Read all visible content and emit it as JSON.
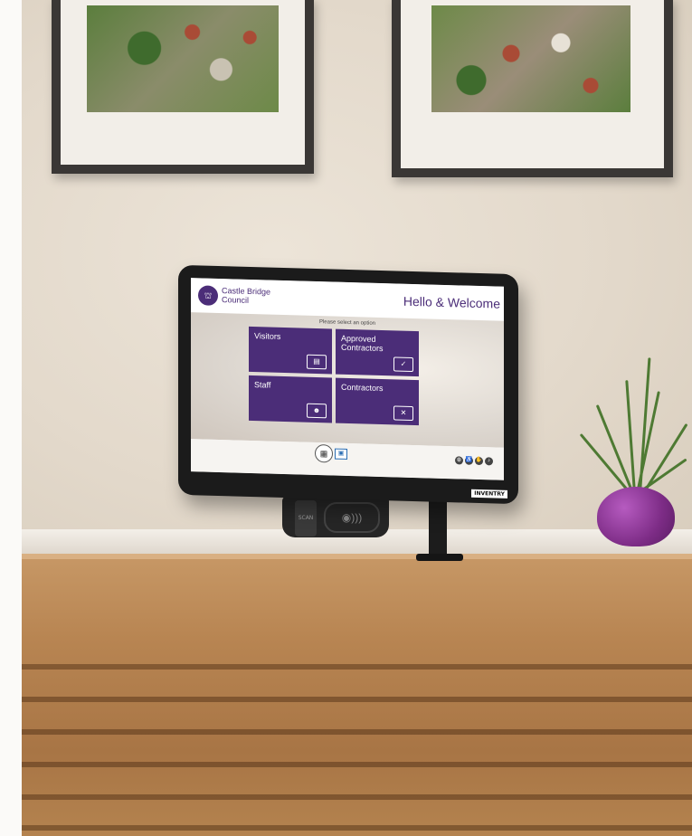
{
  "kiosk_screen": {
    "organization": "Castle Bridge Council",
    "welcome_text": "Hello & Welcome",
    "prompt": "Please select an option",
    "tiles": [
      {
        "label": "Visitors",
        "icon": "id-card-icon",
        "glyph": "▤"
      },
      {
        "label": "Approved Contractors",
        "icon": "tools-check-icon",
        "glyph": "✓"
      },
      {
        "label": "Staff",
        "icon": "people-icon",
        "glyph": "☻"
      },
      {
        "label": "Contractors",
        "icon": "tools-icon",
        "glyph": "✕"
      }
    ],
    "footer": {
      "qr_icon": "qr-code-icon",
      "id_icon": "id-scan-icon",
      "utility_icons": [
        "language-icon",
        "accessibility-icon",
        "sign-language-icon",
        "audio-icon"
      ]
    }
  },
  "device": {
    "brand_badge": "INVENTRY",
    "scanner_label": "SCAN",
    "nfc_icon": "contactless-icon"
  },
  "colors": {
    "brand_purple": "#4b2d78",
    "wall": "#e3d9cb",
    "desk_wood": "#b88552",
    "pot_purple": "#7d2c86"
  }
}
